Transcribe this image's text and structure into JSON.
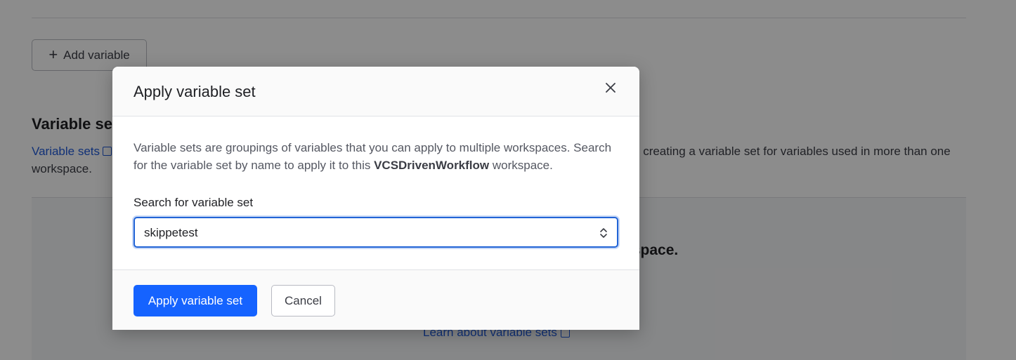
{
  "background": {
    "add_variable_label": "Add variable",
    "variable_sets_heading": "Variable sets",
    "variable_sets_link": "Variable sets",
    "variable_sets_desc_tail": "d creating a variable set for variables used in more than one",
    "variable_sets_desc_line2": "workspace.",
    "empty_state_title": "rkspace.",
    "learn_link": "Learn about variable sets"
  },
  "modal": {
    "title": "Apply variable set",
    "description_part1": "Variable sets are groupings of variables that you can apply to multiple workspaces. Search for the variable set by name to apply it to this ",
    "workspace_name": "VCSDrivenWorkflow",
    "description_part2": " workspace.",
    "field_label": "Search for variable set",
    "search_value": "skippetest",
    "apply_button": "Apply variable set",
    "cancel_button": "Cancel"
  },
  "icons": {
    "close": "close-icon",
    "add": "plus-icon",
    "select_chevrons": "chevron-updown-icon",
    "external_link": "external-link-icon"
  },
  "colors": {
    "primary": "#1563ff",
    "link": "#1f5ad9",
    "focus_border": "#2264d6"
  }
}
